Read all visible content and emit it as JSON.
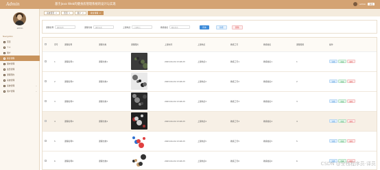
{
  "header": {
    "logo": "Admin",
    "title": "基于Java Web的健身房管理系统的设计与实现",
    "user": "admin",
    "logout": "退出"
  },
  "sidebar": {
    "user_name": "admin",
    "nav_heading": "Navigation",
    "items": [
      {
        "label": "首页",
        "active": false
      },
      {
        "label": "个人",
        "active": false
      },
      {
        "label": "用户",
        "active": false
      },
      {
        "label": "健身课程",
        "active": true
      },
      {
        "label": "器材管理",
        "active": false
      },
      {
        "label": "会员管理",
        "active": false
      },
      {
        "label": "课程预约",
        "active": false
      },
      {
        "label": "系统管理",
        "active": false
      },
      {
        "label": "系统管理",
        "active": false,
        "expand": true
      },
      {
        "label": "用户管理",
        "active": false,
        "expand": true
      }
    ]
  },
  "tabs": [
    {
      "label": "系统首页",
      "active": false
    },
    {
      "label": "首页",
      "active": false
    },
    {
      "label": "用户",
      "active": false
    },
    {
      "label": "健身课程",
      "active": true
    }
  ],
  "search": {
    "fields": [
      {
        "label": "课程名称",
        "placeholder": "课程名称"
      },
      {
        "label": "课程分类",
        "placeholder": "课程分类"
      },
      {
        "label": "上课地点",
        "placeholder": "上课地点"
      },
      {
        "label": "教练姓名",
        "placeholder": "教练姓名"
      }
    ],
    "search_btn": "查询",
    "add_btn": "新增",
    "del_btn": "删除"
  },
  "table": {
    "columns": [
      "",
      "序号",
      "课程名称",
      "课程分类",
      "课程图片",
      "上课时间",
      "上课地点",
      "教练工号",
      "教练姓名",
      "课程费用",
      "操作"
    ],
    "rows": [
      {
        "idx": "1",
        "name": "课程名称1",
        "cat": "课程分类1",
        "time": "2023-04-19 13:18:23",
        "place": "上课地点1",
        "no": "教练工号1",
        "coach": "教练姓名1",
        "fee": "1",
        "img": 1
      },
      {
        "idx": "2",
        "name": "课程名称2",
        "cat": "课程分类2",
        "time": "2023-04-19 13:18:23",
        "place": "上课地点2",
        "no": "教练工号2",
        "coach": "教练姓名2",
        "fee": "2",
        "img": 2
      },
      {
        "idx": "3",
        "name": "课程名称3",
        "cat": "课程分类3",
        "time": "2023-04-19 13:18:23",
        "place": "上课地点3",
        "no": "教练工号3",
        "coach": "教练姓名3",
        "fee": "3",
        "img": 3
      },
      {
        "idx": "4",
        "name": "课程名称4",
        "cat": "课程分类4",
        "time": "2023-04-19 13:18:23",
        "place": "上课地点4",
        "no": "教练工号4",
        "coach": "教练姓名4",
        "fee": "4",
        "img": 4
      },
      {
        "idx": "5",
        "name": "课程名称5",
        "cat": "课程分类5",
        "time": "2023-04-19 13:18:23",
        "place": "上课地点5",
        "no": "教练工号5",
        "coach": "教练姓名5",
        "fee": "5",
        "img": 5
      },
      {
        "idx": "6",
        "name": "课程名称6",
        "cat": "课程分类6",
        "time": "2023-04-19 13:18:23",
        "place": "上课地点6",
        "no": "教练工号6",
        "coach": "教练姓名6",
        "fee": "6",
        "img": 6
      }
    ],
    "actions": {
      "detail": "详情",
      "edit": "修改",
      "del": "删除"
    }
  },
  "watermark": "CSDN @全栈程序员·译员",
  "colors": {
    "brand": "#d4a373",
    "active": "#c8935c",
    "primary": "#3d8bd9"
  },
  "icons": [
    "home-icon",
    "user-icon",
    "list-icon",
    "dumbbell-icon",
    "gear-icon"
  ]
}
